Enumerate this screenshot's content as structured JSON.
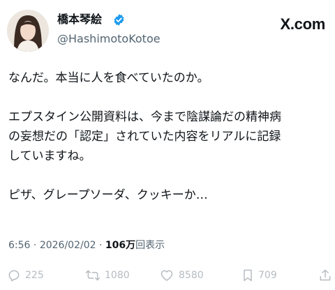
{
  "header": {
    "display_name": "橋本琴絵",
    "handle": "@HashimotoKotoe",
    "brand": "X.com"
  },
  "post": {
    "paragraph1": "なんだ。本当に人を食べていたのか。",
    "paragraph2_line1": "エプスタイン公開資料は、今まで陰謀論だの精神病",
    "paragraph2_line2": "の妄想だの「認定」されていた内容をリアルに記録",
    "paragraph2_line3": "していますね。",
    "paragraph3": "ピザ、グレープソーダ、クッキーか…"
  },
  "meta": {
    "time": "6:56",
    "separator": " · ",
    "date": "2026/02/02",
    "views_count": "106万",
    "views_label": "回表示"
  },
  "actions": {
    "replies": "225",
    "reposts": "1080",
    "likes": "8580",
    "bookmarks": "709"
  },
  "icons": [
    "verified-badge-icon",
    "reply-icon",
    "repost-icon",
    "like-icon",
    "bookmark-icon",
    "share-icon"
  ],
  "colors": {
    "text": "#0f1419",
    "secondary": "#536471",
    "verified": "#1d9bf0",
    "action": "#b6bcc2"
  }
}
